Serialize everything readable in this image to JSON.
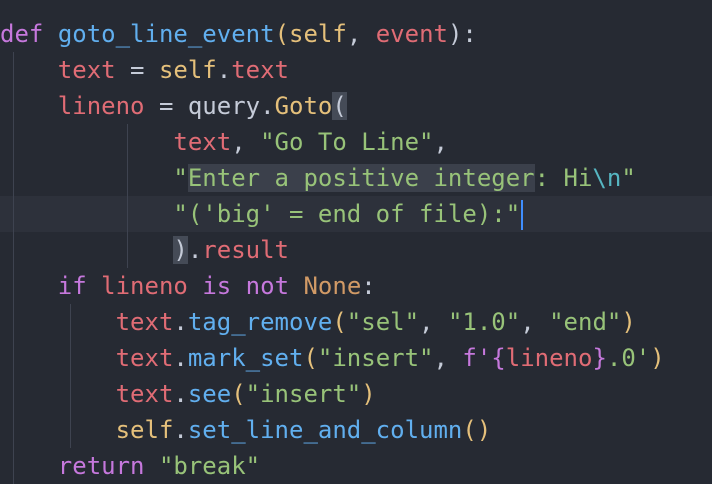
{
  "code": {
    "l1": {
      "kw_def": "def",
      "fn_name": "goto_line_event",
      "lp": "(",
      "self": "self",
      "comma": ", ",
      "param": "event",
      "rp_colon": "):"
    },
    "l2": {
      "indent": "    ",
      "var_text": "text",
      "eq": " = ",
      "self": "self",
      "dot": ".",
      "attr_text": "text"
    },
    "l3": {
      "indent": "    ",
      "var_lineno": "lineno",
      "eq": " = ",
      "module": "query",
      "dot": ".",
      "cls": "Goto",
      "lp": "("
    },
    "l4": {
      "indent": "            ",
      "var_text": "text",
      "comma": ", ",
      "str": "\"Go To Line\"",
      "comma2": ","
    },
    "l5": {
      "indent": "            ",
      "q": "\"",
      "str_sel": "Enter a positive integer",
      "str_rest": ": Hi",
      "esc": "\\n",
      "q2": "\""
    },
    "l6": {
      "indent": "            ",
      "str": "\"('big' = end of file):\""
    },
    "l7": {
      "indent": "            ",
      "rp": ")",
      "dot": ".",
      "attr": "result"
    },
    "l8": {
      "indent": "    ",
      "kw_if": "if",
      "sp1": " ",
      "var_lineno": "lineno",
      "sp2": " ",
      "kw_is": "is",
      "sp3": " ",
      "kw_not": "not",
      "sp4": " ",
      "const_none": "None",
      "colon": ":"
    },
    "l9": {
      "indent": "        ",
      "var_text": "text",
      "dot": ".",
      "method": "tag_remove",
      "lp": "(",
      "s1": "\"sel\"",
      "c1": ", ",
      "s2": "\"1.0\"",
      "c2": ", ",
      "s3": "\"end\"",
      "rp": ")"
    },
    "l10": {
      "indent": "        ",
      "var_text": "text",
      "dot": ".",
      "method": "mark_set",
      "lp": "(",
      "s1": "\"insert\"",
      "c1": ", ",
      "fpre": "f'",
      "lb": "{",
      "var": "lineno",
      "rb": "}",
      "fpost": ".0'",
      "rp": ")"
    },
    "l11": {
      "indent": "        ",
      "var_text": "text",
      "dot": ".",
      "method": "see",
      "lp": "(",
      "s1": "\"insert\"",
      "rp": ")"
    },
    "l12": {
      "indent": "        ",
      "self": "self",
      "dot": ".",
      "method": "set_line_and_column",
      "parens": "()"
    },
    "l13": {
      "indent": "    ",
      "kw_return": "return",
      "sp": " ",
      "str": "\"break\""
    }
  },
  "colors": {
    "background": "#262a33",
    "keyword": "#c678dd",
    "function": "#61afef",
    "string": "#98c379",
    "variable": "#e06c75",
    "self": "#e5c07b",
    "constant": "#d19a66",
    "caret": "#3f8eff"
  }
}
